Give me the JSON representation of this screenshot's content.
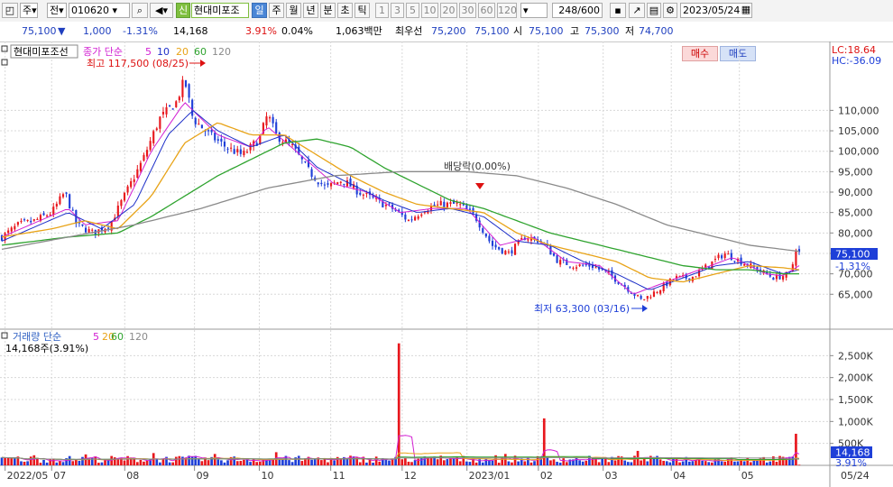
{
  "toolbar": {
    "market": "주",
    "period_prefix": "전",
    "code": "010620",
    "badge": "신",
    "name": "현대미포조",
    "periods": [
      "일",
      "주",
      "월",
      "년",
      "분",
      "초",
      "틱"
    ],
    "active_period": "일",
    "intervals": [
      "1",
      "3",
      "5",
      "10",
      "20",
      "30",
      "60",
      "120"
    ],
    "count": "248/600",
    "date": "2023/05/24"
  },
  "quote": {
    "price": "75,100",
    "arrow": "▼",
    "change": "1,000",
    "change_pct": "-1.31%",
    "volume": "14,168",
    "vol_pct": "3.91%",
    "turnover": "0.04%",
    "amount": "1,063백만",
    "pref_label": "최우선",
    "bid": "75,200",
    "ask": "75,100",
    "open_label": "시",
    "open": "75,100",
    "high_label": "고",
    "high": "75,300",
    "low_label": "저",
    "low": "74,700",
    "buy": "매수",
    "sell": "매도"
  },
  "price_panel": {
    "stock_name": "현대미포조선",
    "legend_prefix": "종가 단순",
    "ma_labels": [
      "5",
      "10",
      "20",
      "60",
      "120"
    ],
    "lc": "LC:18.64",
    "hc": "HC:-36.09",
    "high_annot": "최고 117,500 (08/25)",
    "low_annot": "최저 63,300 (03/16)",
    "dividend_annot": "배당락(0.00%)",
    "last_price_tag": "75,100",
    "last_pct_tag": "-1.31%"
  },
  "volume_panel": {
    "legend_prefix": "거래량 단순",
    "ma_labels": [
      "5",
      "20",
      "60",
      "120"
    ],
    "value_line": "14,168주(3.91%)",
    "last_vol_tag": "14,168",
    "last_pct_tag": "3.91%"
  },
  "colors": {
    "up": "#e8171d",
    "down": "#1e3fd8",
    "ma5": "#d21fd2",
    "ma10": "#1d2fc8",
    "ma20": "#e8a317",
    "ma60": "#2ea32e",
    "ma120": "#8a8a8a",
    "axis_tag": "#1e3fd8"
  },
  "chart_data": [
    {
      "type": "candlestick",
      "title": "현대미포조선",
      "ylim": [
        58000,
        122000
      ],
      "y_ticks": [
        65000,
        70000,
        75000,
        80000,
        85000,
        90000,
        95000,
        100000,
        105000,
        110000
      ],
      "y_tick_labels": [
        "65,000",
        "70,000",
        "75,000",
        "80,000",
        "85,000",
        "90,000",
        "95,000",
        "100,000",
        "105,000",
        "110,000"
      ],
      "x_labels": [
        "2022/05",
        "07",
        "08",
        "09",
        "10",
        "11",
        "12",
        "2023/01",
        "02",
        "03",
        "04",
        "05",
        "05/24"
      ],
      "x_label_positions": [
        0.2,
        3.0,
        7.4,
        11.6,
        15.5,
        19.8,
        24.1,
        28.0,
        32.3,
        36.2,
        40.3,
        44.4,
        49.8
      ],
      "close_keypoints": [
        [
          0,
          79000
        ],
        [
          1,
          82000
        ],
        [
          2,
          83000
        ],
        [
          3,
          85000
        ],
        [
          3.8,
          90000
        ],
        [
          4.5,
          82000
        ],
        [
          5.5,
          80000
        ],
        [
          6.5,
          82000
        ],
        [
          7.5,
          90000
        ],
        [
          8.5,
          98000
        ],
        [
          9.5,
          108000
        ],
        [
          10.5,
          112000
        ],
        [
          11,
          117500
        ],
        [
          11.5,
          108000
        ],
        [
          12.5,
          104000
        ],
        [
          13.5,
          101000
        ],
        [
          14.5,
          99000
        ],
        [
          15.5,
          103000
        ],
        [
          16,
          109000
        ],
        [
          16.5,
          104000
        ],
        [
          17.5,
          101000
        ],
        [
          18.5,
          95000
        ],
        [
          19.5,
          91000
        ],
        [
          20.5,
          93000
        ],
        [
          21.5,
          90000
        ],
        [
          22.5,
          88000
        ],
        [
          23.5,
          86000
        ],
        [
          24.5,
          83000
        ],
        [
          25.5,
          86000
        ],
        [
          26.5,
          87000
        ],
        [
          27.5,
          87000
        ],
        [
          28.5,
          84000
        ],
        [
          29.5,
          77000
        ],
        [
          30.5,
          75000
        ],
        [
          31.5,
          79000
        ],
        [
          32.5,
          78000
        ],
        [
          33.5,
          73000
        ],
        [
          34.5,
          72000
        ],
        [
          35.5,
          72000
        ],
        [
          36.5,
          70000
        ],
        [
          37.5,
          67000
        ],
        [
          38.5,
          63500
        ],
        [
          39.5,
          66000
        ],
        [
          40.5,
          69000
        ],
        [
          41.5,
          69000
        ],
        [
          42.5,
          72000
        ],
        [
          43.5,
          75000
        ],
        [
          44.5,
          73000
        ],
        [
          45.5,
          71000
        ],
        [
          46.5,
          69000
        ],
        [
          47.5,
          70000
        ],
        [
          47.8,
          76500
        ],
        [
          48,
          75100
        ]
      ],
      "series": [
        {
          "name": "5",
          "keypoints": [
            [
              0,
              79000
            ],
            [
              4,
              86000
            ],
            [
              5,
              82000
            ],
            [
              7,
              83000
            ],
            [
              9,
              100000
            ],
            [
              11,
              112000
            ],
            [
              13,
              104000
            ],
            [
              15,
              101000
            ],
            [
              16,
              106000
            ],
            [
              18,
              99000
            ],
            [
              20,
              92000
            ],
            [
              22,
              90000
            ],
            [
              24,
              85000
            ],
            [
              26,
              86000
            ],
            [
              28,
              86000
            ],
            [
              30,
              77000
            ],
            [
              32,
              79000
            ],
            [
              34,
              73000
            ],
            [
              36,
              72000
            ],
            [
              38,
              65000
            ],
            [
              40,
              68000
            ],
            [
              42,
              71000
            ],
            [
              44,
              74000
            ],
            [
              46,
              70000
            ],
            [
              47,
              69500
            ],
            [
              48,
              72000
            ]
          ]
        },
        {
          "name": "10",
          "keypoints": [
            [
              0,
              78000
            ],
            [
              4,
              85000
            ],
            [
              6,
              81000
            ],
            [
              8,
              87000
            ],
            [
              10,
              104000
            ],
            [
              11.5,
              110000
            ],
            [
              13,
              105000
            ],
            [
              15,
              101000
            ],
            [
              17,
              104000
            ],
            [
              19,
              96000
            ],
            [
              21,
              92000
            ],
            [
              23,
              88000
            ],
            [
              25,
              85000
            ],
            [
              27,
              86000
            ],
            [
              29,
              84000
            ],
            [
              31,
              78000
            ],
            [
              33,
              77000
            ],
            [
              35,
              73000
            ],
            [
              37,
              70000
            ],
            [
              39,
              66000
            ],
            [
              41,
              69000
            ],
            [
              43,
              72000
            ],
            [
              45,
              73000
            ],
            [
              47,
              70000
            ],
            [
              48,
              71000
            ]
          ]
        },
        {
          "name": "20",
          "keypoints": [
            [
              0,
              79000
            ],
            [
              3,
              81000
            ],
            [
              5,
              83000
            ],
            [
              7,
              81000
            ],
            [
              9,
              89000
            ],
            [
              11,
              102000
            ],
            [
              13,
              107000
            ],
            [
              15,
              104000
            ],
            [
              17,
              104000
            ],
            [
              19,
              99000
            ],
            [
              21,
              94000
            ],
            [
              23,
              90000
            ],
            [
              25,
              87000
            ],
            [
              27,
              86000
            ],
            [
              29,
              85000
            ],
            [
              31,
              80000
            ],
            [
              33,
              77000
            ],
            [
              35,
              75000
            ],
            [
              37,
              73000
            ],
            [
              39,
              69000
            ],
            [
              41,
              68000
            ],
            [
              43,
              70000
            ],
            [
              45,
              72000
            ],
            [
              47,
              71500
            ],
            [
              48,
              71000
            ]
          ]
        },
        {
          "name": "60",
          "keypoints": [
            [
              0,
              77000
            ],
            [
              4,
              79000
            ],
            [
              7,
              80000
            ],
            [
              9,
              84000
            ],
            [
              11,
              89000
            ],
            [
              13,
              94000
            ],
            [
              15,
              98000
            ],
            [
              17,
              102000
            ],
            [
              19,
              103000
            ],
            [
              21,
              101000
            ],
            [
              23,
              96000
            ],
            [
              25,
              92000
            ],
            [
              27,
              88000
            ],
            [
              29,
              86000
            ],
            [
              31,
              83000
            ],
            [
              33,
              80000
            ],
            [
              35,
              78000
            ],
            [
              37,
              76000
            ],
            [
              39,
              74000
            ],
            [
              41,
              72000
            ],
            [
              43,
              71000
            ],
            [
              45,
              71000
            ],
            [
              47,
              70000
            ],
            [
              48,
              70000
            ]
          ]
        },
        {
          "name": "120",
          "keypoints": [
            [
              0,
              76000
            ],
            [
              4,
              79000
            ],
            [
              8,
              82000
            ],
            [
              12,
              86000
            ],
            [
              16,
              91000
            ],
            [
              20,
              94000
            ],
            [
              24,
              95000
            ],
            [
              28,
              95000
            ],
            [
              31,
              94000
            ],
            [
              34,
              91000
            ],
            [
              37,
              87000
            ],
            [
              40,
              82000
            ],
            [
              43,
              79000
            ],
            [
              45,
              77000
            ],
            [
              47,
              76000
            ],
            [
              48,
              75500
            ]
          ]
        }
      ]
    },
    {
      "type": "bar",
      "title": "거래량",
      "ylim": [
        0,
        3000000
      ],
      "y_ticks": [
        500000,
        1000000,
        1500000,
        2000000,
        2500000
      ],
      "y_tick_labels": [
        "500K",
        "1,000K",
        "1,500K",
        "2,000K",
        "2,500K"
      ],
      "spikes": [
        [
          2,
          230000
        ],
        [
          5,
          250000
        ],
        [
          9.2,
          280000
        ],
        [
          12.8,
          260000
        ],
        [
          16.5,
          300000
        ],
        [
          21,
          220000
        ],
        [
          23.9,
          2780000
        ],
        [
          26.5,
          220000
        ],
        [
          29.7,
          230000
        ],
        [
          30.3,
          260000
        ],
        [
          32.6,
          1070000
        ],
        [
          38.2,
          330000
        ],
        [
          47.9,
          720000
        ]
      ],
      "last_value": 14168
    }
  ]
}
